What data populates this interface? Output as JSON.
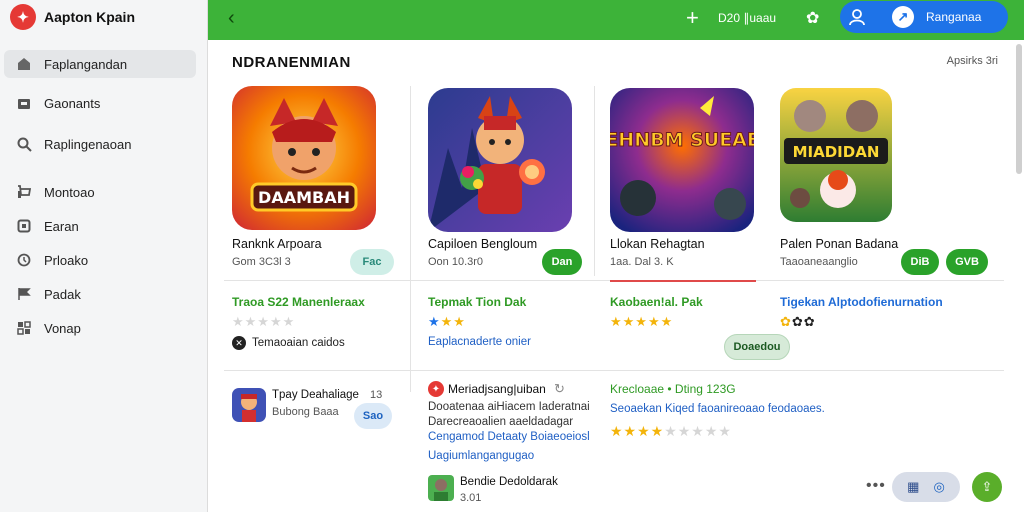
{
  "app": {
    "title": "Aapton Kpain"
  },
  "topbar": {
    "back_icon": "chevron-left-icon",
    "stat": "D20 ∥uaau",
    "account": {
      "label": "Ranganaa"
    }
  },
  "sidebar": {
    "items": [
      {
        "label": "Faplangandan",
        "icon": "home-icon",
        "active": true
      },
      {
        "label": "Gaonants",
        "icon": "store-icon"
      },
      {
        "label": "Raplingenaoan",
        "icon": "search-icon"
      },
      {
        "label": "Montoao",
        "icon": "cart-icon"
      },
      {
        "label": "Earan",
        "icon": "bag-icon"
      },
      {
        "label": "Prloako",
        "icon": "clock-icon"
      },
      {
        "label": "Padak",
        "icon": "flag-icon"
      },
      {
        "label": "Vonap",
        "icon": "grid-icon"
      }
    ]
  },
  "main": {
    "title": "NDRANENMIAN",
    "meta": "Apsirks 3ri",
    "apps": [
      {
        "name": "Ranknk Arpoara",
        "sub": "Gom 3C3l 3",
        "button": "Fac",
        "promo": "Traoa S22 Manenleraax",
        "rating": 0,
        "extra": "Temaoaian caidos"
      },
      {
        "name": "Capiloen Bengloum",
        "sub": "Oon 10.3r0",
        "button": "Dan",
        "promo": "Tepmak Tion Dak",
        "rating": 3,
        "extra": "Eaplacnaderte onier"
      },
      {
        "name": "Llokan Rehagtan",
        "sub": "1aa. Dal 3. K",
        "promo": "Kaobaen!al. Pak",
        "rating": 5,
        "button": "Doaedou"
      },
      {
        "name": "Palen Ponan Badana",
        "sub": "Taaoaneaanglio",
        "buttons": [
          "DiB",
          "GVB"
        ],
        "promo": "Tigekan Alptodofienurnation",
        "rating": 3
      }
    ],
    "tile_texts": [
      "DAAMBAH",
      "NEHNBM SUEAEK",
      "MIADIDAN"
    ]
  },
  "lower": {
    "left": {
      "title": "Tpay Deahaliage",
      "num": "13",
      "sub": "Bubong Baaa",
      "button": "Sao"
    },
    "mid": {
      "title": "Meriadjsang|uiban",
      "lines": [
        "Dooatenaa aiHiacem Iaderatnai",
        "Darecreaoalien aaeldadagar",
        "Cengamod Detaaty Boiaeoeiosl"
      ],
      "link": "Uagiumlangangugao",
      "author": "Bendie Dedoldarak",
      "author_sub": "3.01"
    },
    "right": {
      "title": "Krecloaae • Dting 123G",
      "desc": "Seoaekan Kiqed faoanireoaao feodaoaes.",
      "rating": 4.5
    }
  },
  "colors": {
    "accent": "#3db339",
    "brand_red": "#e53935",
    "blue": "#1e73e8"
  }
}
